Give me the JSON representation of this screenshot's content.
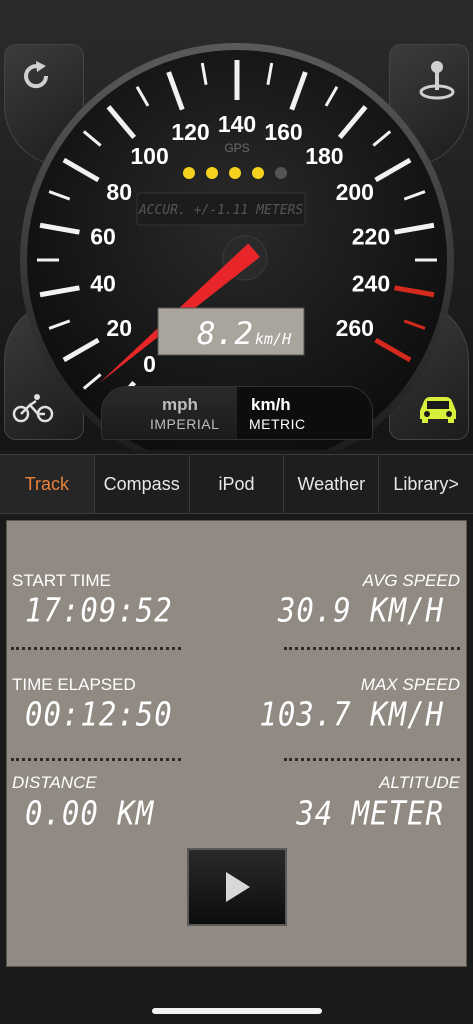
{
  "gauge": {
    "gps_label": "GPS",
    "accuracy_text": "ACCUR. +/-1.11 METERS",
    "speed_display": "8.2",
    "speed_unit": "km/H",
    "dial_labels": [
      "0",
      "20",
      "40",
      "60",
      "80",
      "100",
      "120",
      "140",
      "160",
      "180",
      "200",
      "220",
      "240",
      "260"
    ],
    "gps_dots": [
      "#f5d21e",
      "#f5d21e",
      "#f5d21e",
      "#f5d21e",
      "#555555"
    ],
    "needle_speed": 8.2,
    "dial_max": 260,
    "redline_start": 240
  },
  "unit_toggle": {
    "imperial_main": "mph",
    "imperial_sub": "IMPERIAL",
    "metric_main": "km/h",
    "metric_sub": "METRIC",
    "selected": "metric"
  },
  "tabs": [
    "Track",
    "Compass",
    "iPod",
    "Weather",
    "Library>"
  ],
  "active_tab": "Track",
  "track": {
    "start_time": {
      "label": "START TIME",
      "value": "17:09:52"
    },
    "avg_speed": {
      "label": "AVG SPEED",
      "value": "30.9 KM/H"
    },
    "time_elapsed": {
      "label": "TIME ELAPSED",
      "value": "00:12:50"
    },
    "max_speed": {
      "label": "MAX SPEED",
      "value": "103.7 KM/H"
    },
    "distance": {
      "label": "DISTANCE",
      "value": "0.00 KM"
    },
    "altitude": {
      "label": "ALTITUDE",
      "value": "34 METER"
    }
  },
  "colors": {
    "accent_tab": "#e8823a",
    "needle": "#e8262a",
    "car_icon": "#d8f03c",
    "panel": "#908a82"
  },
  "icons": {
    "top_left": "refresh-icon",
    "top_right": "joystick-icon",
    "bottom_left": "bicycle-icon",
    "bottom_right": "car-icon",
    "play": "play-icon"
  }
}
